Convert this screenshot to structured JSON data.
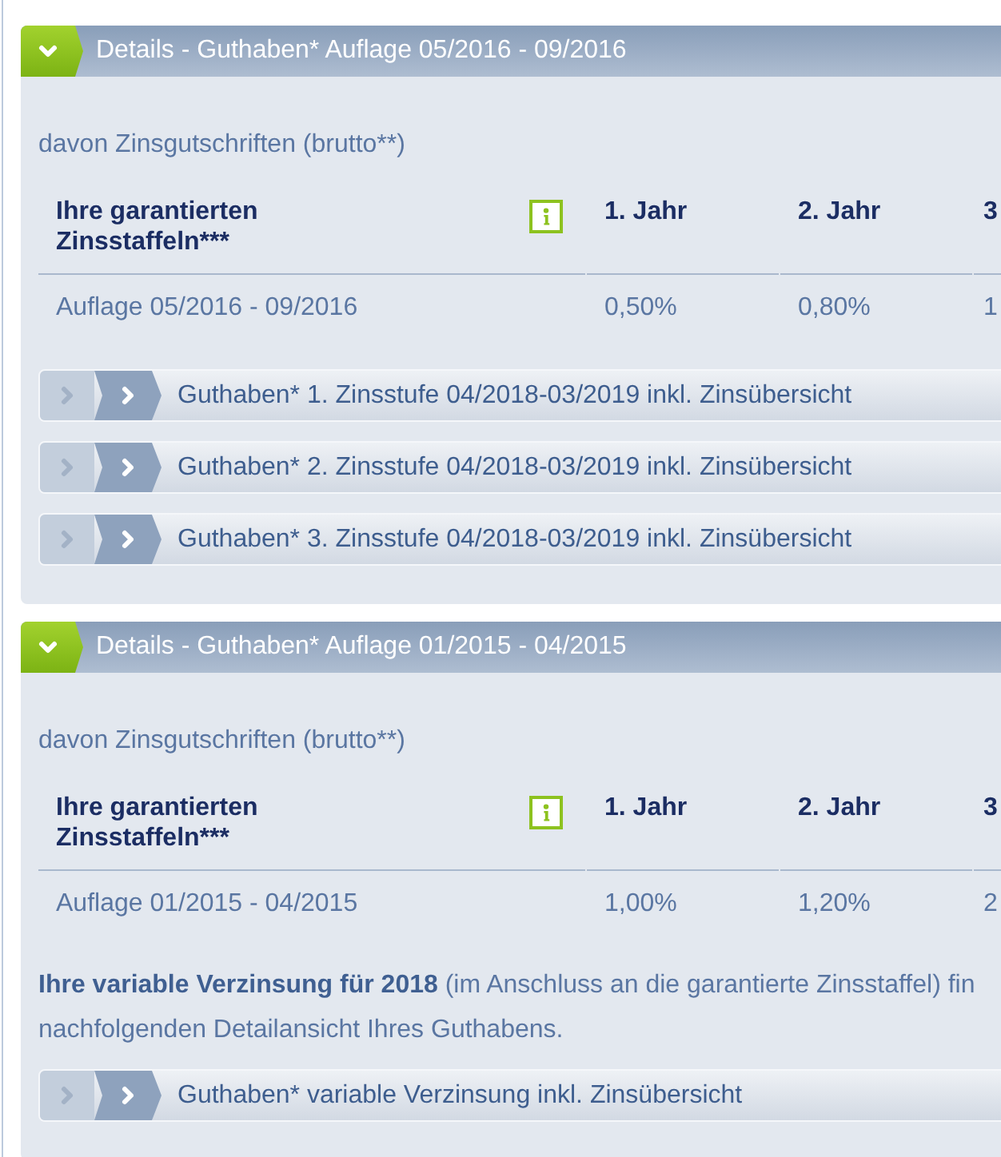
{
  "sections": [
    {
      "title": "Details - Guthaben* Auflage 05/2016 - 09/2016",
      "expanded": true,
      "subtitle": "davon Zinsgutschriften (brutto**)",
      "table": {
        "columns": [
          "Ihre garantierten Zinsstaffeln***",
          "1. Jahr",
          "2. Jahr",
          "3"
        ],
        "rows": [
          [
            "Auflage 05/2016 - 09/2016",
            "0,50%",
            "0,80%",
            "1"
          ]
        ]
      },
      "links": [
        {
          "label": "Guthaben* 1. Zinsstufe 04/2018-03/2019 inkl. Zinsübersicht",
          "expanded": false
        },
        {
          "label": "Guthaben* 2. Zinsstufe 04/2018-03/2019 inkl. Zinsübersicht",
          "expanded": false
        },
        {
          "label": "Guthaben* 3. Zinsstufe 04/2018-03/2019 inkl. Zinsübersicht",
          "expanded": false
        }
      ]
    },
    {
      "title": "Details - Guthaben* Auflage 01/2015 - 04/2015",
      "expanded": true,
      "subtitle": "davon Zinsgutschriften (brutto**)",
      "table": {
        "columns": [
          "Ihre garantierten Zinsstaffeln***",
          "1. Jahr",
          "2. Jahr",
          "3"
        ],
        "rows": [
          [
            "Auflage 01/2015 - 04/2015",
            "1,00%",
            "1,20%",
            "2"
          ]
        ]
      },
      "note": [
        "**Ihre variable Verzinsung für 2018** (im Anschluss an die garantierte Zinsstaffel) fin",
        "nachfolgenden Detailansicht Ihres Guthabens."
      ],
      "links": [
        {
          "label": "Guthaben* variable Verzinsung inkl. Zinsübersicht",
          "expanded": false
        }
      ]
    }
  ]
}
